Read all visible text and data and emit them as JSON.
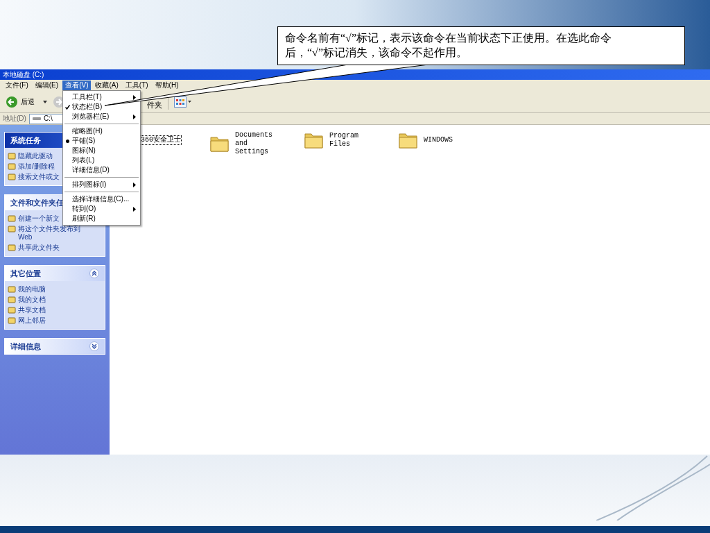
{
  "callout": {
    "text": "命令名前有“√”标记，表示该命令在当前状态下正使用。在选此命令后，“√”标记消失，该命令不起作用。"
  },
  "window": {
    "title": "本地磁盘 (C:)"
  },
  "menu_bar": [
    {
      "label": "文件(F)",
      "selected": false
    },
    {
      "label": "编辑(E)",
      "selected": false
    },
    {
      "label": "查看(V)",
      "selected": true
    },
    {
      "label": "收藏(A)",
      "selected": false
    },
    {
      "label": "工具(T)",
      "selected": false
    },
    {
      "label": "帮助(H)",
      "selected": false
    }
  ],
  "toolbar": {
    "back": "后退",
    "folders": "件夹"
  },
  "address_bar": {
    "label": "地址(D)",
    "value": "C:\\"
  },
  "view_menu": {
    "items": [
      {
        "kind": "check",
        "label": "工具栏(T)",
        "checked": false,
        "submenu": true
      },
      {
        "kind": "check",
        "label": "状态栏(B)",
        "checked": true,
        "submenu": false
      },
      {
        "kind": "check",
        "label": "浏览器栏(E)",
        "checked": false,
        "submenu": true
      },
      {
        "kind": "separator"
      },
      {
        "kind": "radio",
        "label": "缩略图(H)",
        "checked": false,
        "submenu": false
      },
      {
        "kind": "radio",
        "label": "平铺(S)",
        "checked": true,
        "submenu": false
      },
      {
        "kind": "radio",
        "label": "图标(N)",
        "checked": false,
        "submenu": false
      },
      {
        "kind": "radio",
        "label": "列表(L)",
        "checked": false,
        "submenu": false
      },
      {
        "kind": "radio",
        "label": "详细信息(D)",
        "checked": false,
        "submenu": false
      },
      {
        "kind": "separator"
      },
      {
        "kind": "check",
        "label": "排列图标(I)",
        "checked": false,
        "submenu": true
      },
      {
        "kind": "separator"
      },
      {
        "kind": "check",
        "label": "选择详细信息(C)...",
        "checked": false,
        "submenu": false
      },
      {
        "kind": "check",
        "label": "转到(O)",
        "checked": false,
        "submenu": true
      },
      {
        "kind": "check",
        "label": "刷新(R)",
        "checked": false,
        "submenu": false
      }
    ]
  },
  "sidebar": {
    "groups": [
      {
        "kind": "special",
        "title": "系统任务",
        "items": [
          "隐藏此驱动",
          "添加/删除程",
          "搜索文件或文"
        ]
      },
      {
        "kind": "normal",
        "title": "文件和文件夹任",
        "items": [
          "创建一个新文",
          "将这个文件夹发布到 Web",
          "共享此文件夹"
        ]
      },
      {
        "kind": "normal",
        "title": "其它位置",
        "expanded": true,
        "items": [
          "我的电脑",
          "我的文档",
          "共享文档",
          "网上邻居"
        ]
      },
      {
        "kind": "normal",
        "title": "详细信息",
        "expanded": false
      }
    ]
  },
  "files": [
    {
      "name": "360安全卫士",
      "focused": true
    },
    {
      "name": "Documents and Settings",
      "focused": false
    },
    {
      "name": "Program Files",
      "focused": false
    },
    {
      "name": "WINDOWS",
      "focused": false
    }
  ]
}
